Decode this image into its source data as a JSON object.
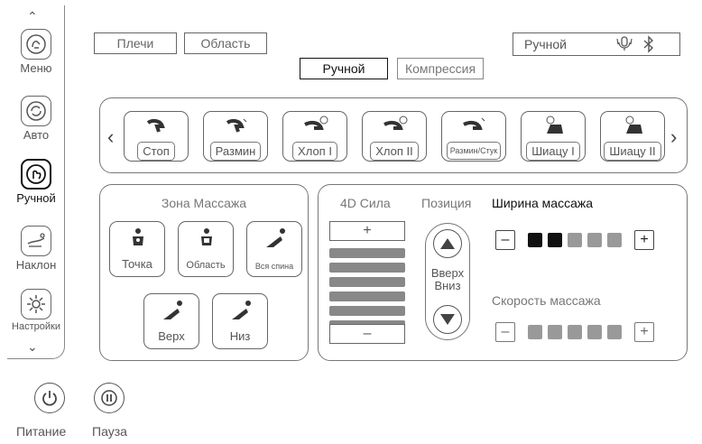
{
  "sidebar": {
    "items": [
      {
        "label": "Меню",
        "icon": "hand-wave-icon"
      },
      {
        "label": "Авто",
        "icon": "auto-cycle-icon"
      },
      {
        "label": "Ручной",
        "icon": "hand-pointer-icon",
        "active": true
      },
      {
        "label": "Наклон",
        "icon": "recline-icon"
      },
      {
        "label": "Настройки",
        "icon": "gear-icon"
      }
    ]
  },
  "top": {
    "area_buttons": [
      "Плечи",
      "Область"
    ],
    "modes": {
      "manual": "Ручной",
      "compression": "Компрессия"
    },
    "status": {
      "mode": "Ручной"
    }
  },
  "programs": [
    {
      "label": "Стоп"
    },
    {
      "label": "Размин"
    },
    {
      "label": "Хлоп I"
    },
    {
      "label": "Хлоп II"
    },
    {
      "label": "Размин/Стук"
    },
    {
      "label": "Шиацу I"
    },
    {
      "label": "Шиацу II"
    }
  ],
  "zone": {
    "title": "Зона Массажа",
    "buttons": [
      "Точка",
      "Область",
      "Вся спина",
      "Верх",
      "Низ"
    ]
  },
  "controls": {
    "force_title": "4D Сила",
    "force_plus": "+",
    "force_minus": "–",
    "force_bars": 6,
    "position_title": "Позиция",
    "position_up": "Вверх",
    "position_down": "Вниз",
    "width_title": "Ширина массажа",
    "width_level": 2,
    "width_max": 5,
    "speed_title": "Скорость массажа",
    "speed_level": 0,
    "speed_max": 5,
    "minus": "–",
    "plus": "+"
  },
  "bottom": {
    "power": "Питание",
    "pause": "Пауза"
  },
  "colors": {
    "active": "#111111",
    "inactive_level": "#999999",
    "border": "#777777"
  }
}
